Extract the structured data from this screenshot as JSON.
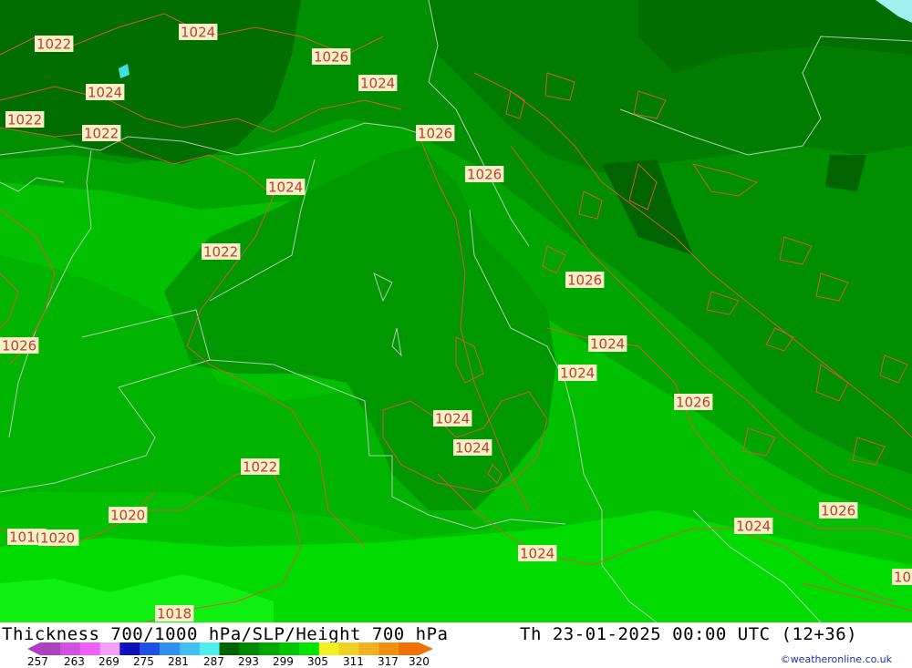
{
  "title": "Thickness 700/1000 hPa/SLP/Height 700 hPa",
  "datetime": "Th 23-01-2025 00:00 UTC (12+36)",
  "credit": "©weatheronline.co.uk",
  "legend": {
    "ticks": [
      "257",
      "263",
      "269",
      "275",
      "281",
      "287",
      "293",
      "299",
      "305",
      "311",
      "317",
      "320"
    ],
    "colors": [
      "#b040c0",
      "#d050e0",
      "#f060f8",
      "#f0a0f8",
      "#1010c0",
      "#2050e8",
      "#3090f0",
      "#40c0f0",
      "#50f0f0",
      "#006400",
      "#008a00",
      "#00a800",
      "#00c800",
      "#00e600",
      "#f0f020",
      "#f0d020",
      "#f0b020",
      "#f09010",
      "#f07000"
    ]
  },
  "map": {
    "colors": {
      "darkest": "#006e00",
      "dark": "#007d00",
      "mid": "#008f00",
      "light": "#00a500",
      "lighter": "#00c000",
      "lightest": "#00dc00",
      "brightest": "#10f010",
      "contour": "#d05a3a",
      "border": "#b8c8b8",
      "water": "#40e0e0"
    },
    "labels": [
      "1022",
      "1024",
      "1026",
      "1024",
      "1024",
      "1022",
      "1022",
      "1026",
      "1024",
      "1026",
      "1022",
      "1026",
      "1024",
      "1024",
      "1026",
      "1024",
      "1024",
      "1022",
      "1020",
      "1020",
      "101(",
      "1020",
      "1018",
      "1024",
      "1024",
      "1026",
      "1026",
      "10"
    ]
  }
}
